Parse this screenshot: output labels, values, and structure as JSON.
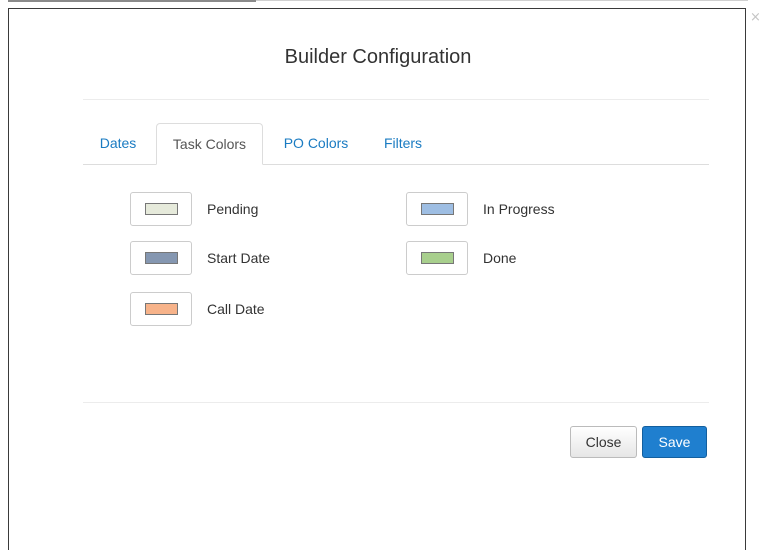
{
  "modal": {
    "title": "Builder Configuration",
    "close_glyph": "×"
  },
  "tabs": [
    {
      "label": "Dates",
      "active": false
    },
    {
      "label": "Task Colors",
      "active": true
    },
    {
      "label": "PO Colors",
      "active": false
    },
    {
      "label": "Filters",
      "active": false
    }
  ],
  "task_colors": [
    {
      "label": "Pending",
      "color": "#e6eadb"
    },
    {
      "label": "Start Date",
      "color": "#8597b1"
    },
    {
      "label": "Call Date",
      "color": "#f7b38a"
    },
    {
      "label": "In Progress",
      "color": "#9ebee3"
    },
    {
      "label": "Done",
      "color": "#a8cf8d"
    }
  ],
  "footer": {
    "close_label": "Close",
    "save_label": "Save"
  },
  "colors": {
    "accent": "#1f7fcf",
    "link": "#1a7bc2"
  }
}
